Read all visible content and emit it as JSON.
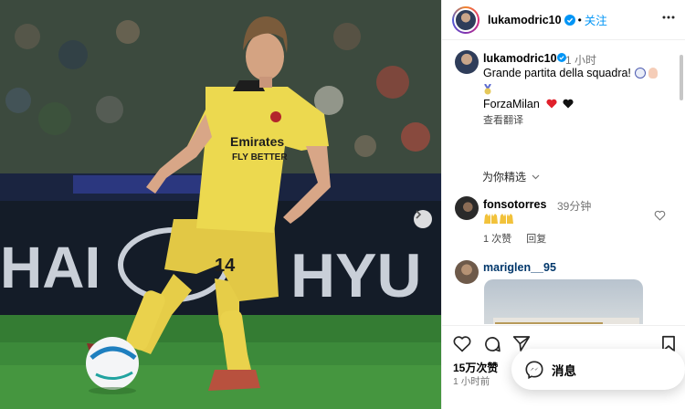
{
  "header": {
    "username": "lukamodric10",
    "separator": "•",
    "follow_label": "关注",
    "icons": {
      "avatar": "profile-avatar",
      "verified": "verified-badge-icon",
      "more": "more-options-icon"
    }
  },
  "photo": {
    "shirt_text_line1": "Emirates",
    "shirt_text_line2": "FLY BETTER",
    "shorts_number": "14",
    "board_text_left": "HAI",
    "board_text_right": "HYU",
    "next_icon": "chevron-right-icon"
  },
  "caption": {
    "username": "lukamodric10",
    "time": "1 小时",
    "line1": "Grande partita della squadra!",
    "line2": "ForzaMilan",
    "translate_label": "查看翻译"
  },
  "sort_label": "为你精选",
  "comments": [
    {
      "username": "fonsotorres",
      "time": "39分钟",
      "likes_label": "1 次赞",
      "reply_label": "回复"
    },
    {
      "username": "mariglen__95"
    }
  ],
  "footer": {
    "likes": "15万次赞",
    "time": "1 小时前"
  },
  "messages": {
    "label": "消息",
    "icon": "messenger-icon"
  },
  "colors": {
    "link_blue": "#0095f6",
    "verified_blue": "#0095f6",
    "heart_red": "#ed4956",
    "jersey_yellow": "#e9d44b"
  }
}
